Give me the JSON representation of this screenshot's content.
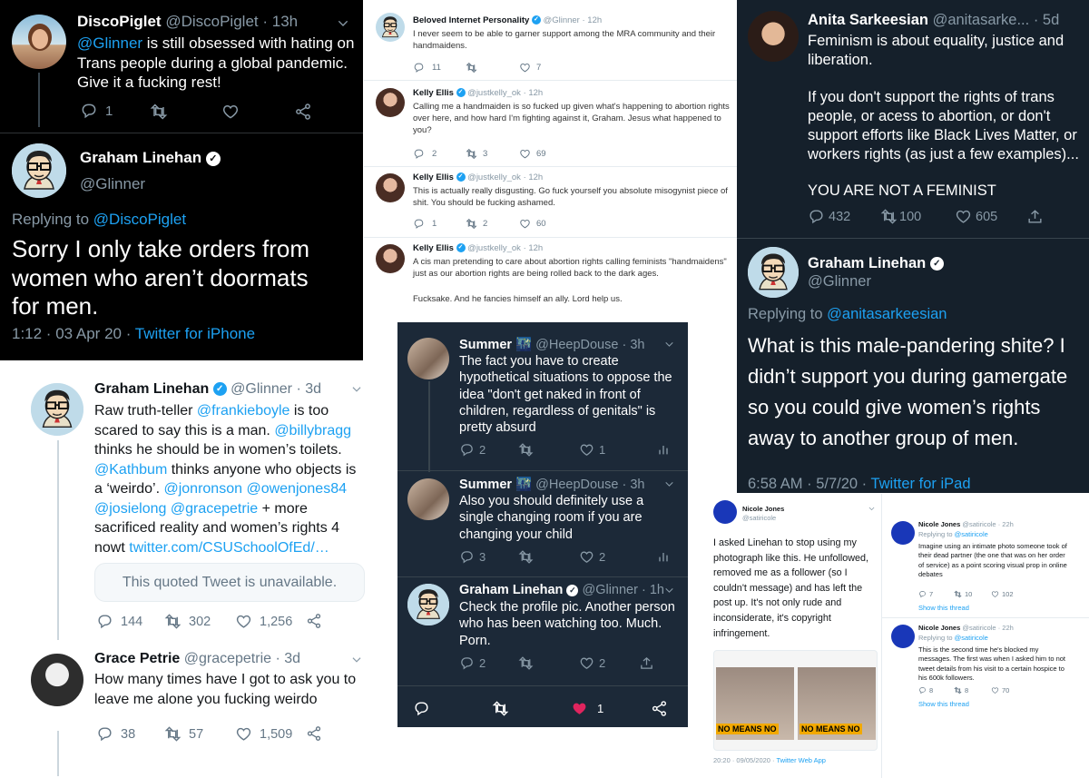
{
  "p1": {
    "t1": {
      "name": "DiscoPiglet",
      "handle": "@DiscoPiglet",
      "time": "· 13h",
      "mention": "@Glinner",
      "text": " is still obsessed with hating on Trans people during a global pandemic. Give it a fucking rest!",
      "replies": "1"
    },
    "t2": {
      "name": "Graham Linehan",
      "handle": "@Glinner",
      "replying": "Replying to ",
      "replying_to": "@DiscoPiglet",
      "text": "Sorry I only take orders from women who aren’t doormats for men.",
      "time": "1:12 · 03 Apr 20 · ",
      "client": "Twitter for iPhone"
    }
  },
  "p2": {
    "t1": {
      "name": "Beloved Internet Personality",
      "handle": "@Glinner",
      "time": "· 12h",
      "text": "I never seem to be able to garner support among the MRA community and their handmaidens.",
      "replies": "11",
      "likes": "7"
    },
    "t2": {
      "name": "Kelly Ellis",
      "handle": "@justkelly_ok",
      "time": "· 12h",
      "text": "Calling me a handmaiden is so fucked up given what's happening to abortion rights over here, and how hard I'm fighting against it, Graham. Jesus what happened to you?",
      "replies": "2",
      "rts": "3",
      "likes": "69"
    },
    "t3": {
      "name": "Kelly Ellis",
      "handle": "@justkelly_ok",
      "time": "· 12h",
      "text": "This is actually really disgusting. Go fuck yourself you absolute misogynist piece of shit. You should be fucking ashamed.",
      "replies": "1",
      "rts": "2",
      "likes": "60"
    },
    "t4": {
      "name": "Kelly Ellis",
      "handle": "@justkelly_ok",
      "time": "· 12h",
      "text": "A cis man pretending to care about abortion rights calling feminists \"handmaidens\" just as our abortion rights are being rolled back to the dark ages.",
      "text2": "Fucksake. And he fancies himself an ally. Lord help us."
    }
  },
  "p3": {
    "t1": {
      "name": "Anita Sarkeesian",
      "handle": "@anitasarke...",
      "time": "· 5d",
      "text1": "Feminism is about equality, justice and liberation.",
      "text2": "If you don't support the rights of trans people, or acess to abortion, or don't support efforts like Black Lives Matter, or workers rights (as just a few examples)...",
      "text3": "YOU ARE NOT A FEMINIST",
      "replies": "432",
      "rts": "100",
      "likes": "605"
    },
    "t2": {
      "name": "Graham Linehan",
      "handle": "@Glinner",
      "replying": "Replying to ",
      "replying_to": "@anitasarkeesian",
      "text": "What is this male-pandering shite? I didn’t support you during gamergate so you could give women’s rights away to another group of men.",
      "time": "6:58 AM · 5/7/20 · ",
      "client": "Twitter for iPad"
    }
  },
  "p4": {
    "t1": {
      "name": "Graham Linehan",
      "handle": "@Glinner",
      "time": "· 3d",
      "s1": "Raw truth-teller ",
      "m1": "@frankieboyle",
      "s2": " is too scared to say this is a man. ",
      "m2": "@billybragg",
      "s3": " thinks he should be in women’s toilets. ",
      "m3": "@Kathbum",
      "s4": " thinks anyone who objects is a ‘weirdo’. ",
      "m4": "@jonronson",
      "s5": " ",
      "m5": "@owenjones84",
      "s6": " ",
      "m6": "@josielong",
      "s7": " ",
      "m7": "@gracepetrie",
      "s8": " + more sacrificed reality and women’s rights 4 nowt ",
      "link": "twitter.com/CSUSchoolOfEd/…",
      "quoted": "This quoted Tweet is unavailable.",
      "replies": "144",
      "rts": "302",
      "likes": "1,256"
    },
    "t2": {
      "name": "Grace Petrie",
      "handle": "@gracepetrie",
      "time": "· 3d",
      "text": "How many times have I got to ask you to leave me alone you fucking weirdo",
      "replies": "38",
      "rts": "57",
      "likes": "1,509"
    }
  },
  "p5": {
    "t1": {
      "name": "Summer 🌃",
      "handle": "@HeepDouse",
      "time": "· 3h",
      "text": "The fact you have to create hypothetical situations to oppose the idea \"don't get naked in front of children, regardless of genitals\" is pretty absurd",
      "replies": "2",
      "likes": "1"
    },
    "t2": {
      "name": "Summer 🌃",
      "handle": "@HeepDouse",
      "time": "· 3h",
      "text": "Also you should definitely use a single changing room if you are changing your child",
      "replies": "3",
      "likes": "2"
    },
    "t3": {
      "name": "Graham Linehan",
      "handle": "@Glinner",
      "time": "· 1h",
      "text": "Check the profile pic. Another person who has been watching too. Much. Porn.",
      "replies": "2",
      "likes": "2"
    },
    "bottom": {
      "likes": "1"
    }
  },
  "p6": {
    "main": {
      "name": "Nicole Jones",
      "handle": "@satiricole",
      "text": "I asked Linehan to stop using my photograph like this. He unfollowed, removed me as a follower (so I couldn't message) and has left the post up. It's not only rude and inconsiderate, it's copyright infringement.",
      "img_label": "NO MEANS NO",
      "img_label2": "NO MEANS NO",
      "time": "20:20 · 09/05/2020 · ",
      "client": "Twitter Web App"
    },
    "r1": {
      "name": "Nicole Jones",
      "handle": "@satiricole",
      "time": "· 22h",
      "replying": "Replying to ",
      "replying_to": "@satiricole",
      "text": "Imagine using an intimate photo someone took of their dead partner (the one that was on her order of service) as a point scoring visual prop in online debates",
      "replies": "7",
      "rts": "10",
      "likes": "102",
      "show": "Show this thread"
    },
    "r2": {
      "name": "Nicole Jones",
      "handle": "@satiricole",
      "time": "· 22h",
      "replying": "Replying to ",
      "replying_to": "@satiricole",
      "text": "This is the second time he's blocked my messages. The first was when I asked him to not tweet details from his visit to a certain hospice to his 600k followers.",
      "replies": "8",
      "rts": "8",
      "likes": "70",
      "show": "Show this thread"
    }
  },
  "icons": [
    "reply-icon",
    "retweet-icon",
    "like-icon",
    "share-icon",
    "analytics-icon",
    "verified-icon",
    "chevron-down-icon"
  ],
  "colors": {
    "twitter_blue": "#1da1f2",
    "dark_bg": "#000000",
    "dim_bg": "#15202b",
    "like_red": "#e0245e"
  }
}
